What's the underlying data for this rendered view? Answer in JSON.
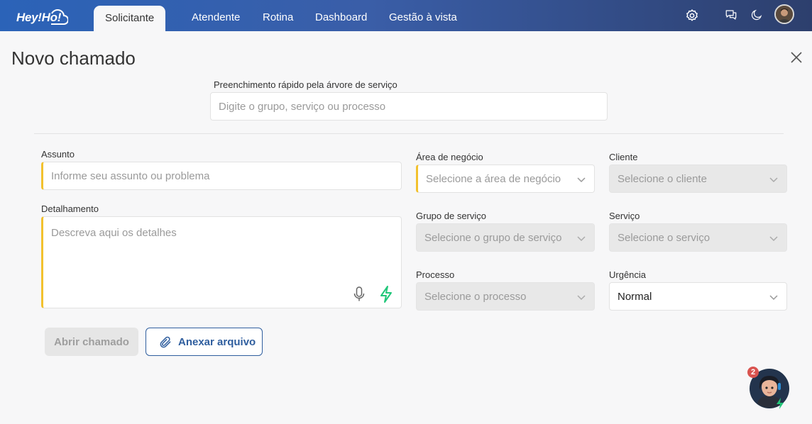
{
  "app": {
    "logo_text": "Hey!Ho!"
  },
  "nav": {
    "tabs": [
      {
        "label": "Solicitante",
        "active": true
      },
      {
        "label": "Atendente"
      },
      {
        "label": "Rotina"
      },
      {
        "label": "Dashboard"
      },
      {
        "label": "Gestão à vista"
      }
    ],
    "icons": [
      "gear-icon",
      "chat-icon",
      "moon-icon"
    ]
  },
  "page": {
    "title": "Novo chamado"
  },
  "quick_fill": {
    "label": "Preenchimento rápido pela árvore de serviço",
    "placeholder": "Digite o grupo, serviço ou processo"
  },
  "form": {
    "subject": {
      "label": "Assunto",
      "placeholder": "Informe seu assunto ou problema"
    },
    "details": {
      "label": "Detalhamento",
      "placeholder": "Descreva aqui os detalhes"
    },
    "business_area": {
      "label": "Área de negócio",
      "placeholder": "Selecione a área de negócio"
    },
    "client": {
      "label": "Cliente",
      "placeholder": "Selecione o cliente"
    },
    "service_group": {
      "label": "Grupo de serviço",
      "placeholder": "Selecione o grupo de serviço"
    },
    "service": {
      "label": "Serviço",
      "placeholder": "Selecione o serviço"
    },
    "process": {
      "label": "Processo",
      "placeholder": "Selecione o processo"
    },
    "urgency": {
      "label": "Urgência",
      "value": "Normal"
    }
  },
  "actions": {
    "open_ticket": "Abrir chamado",
    "attach_file": "Anexar arquivo"
  },
  "assistant": {
    "badge_count": "2"
  },
  "colors": {
    "required_accent": "#f2c12e",
    "brand": "#2f5e9e",
    "badge": "#d9534f",
    "bolt": "#22c77a"
  }
}
